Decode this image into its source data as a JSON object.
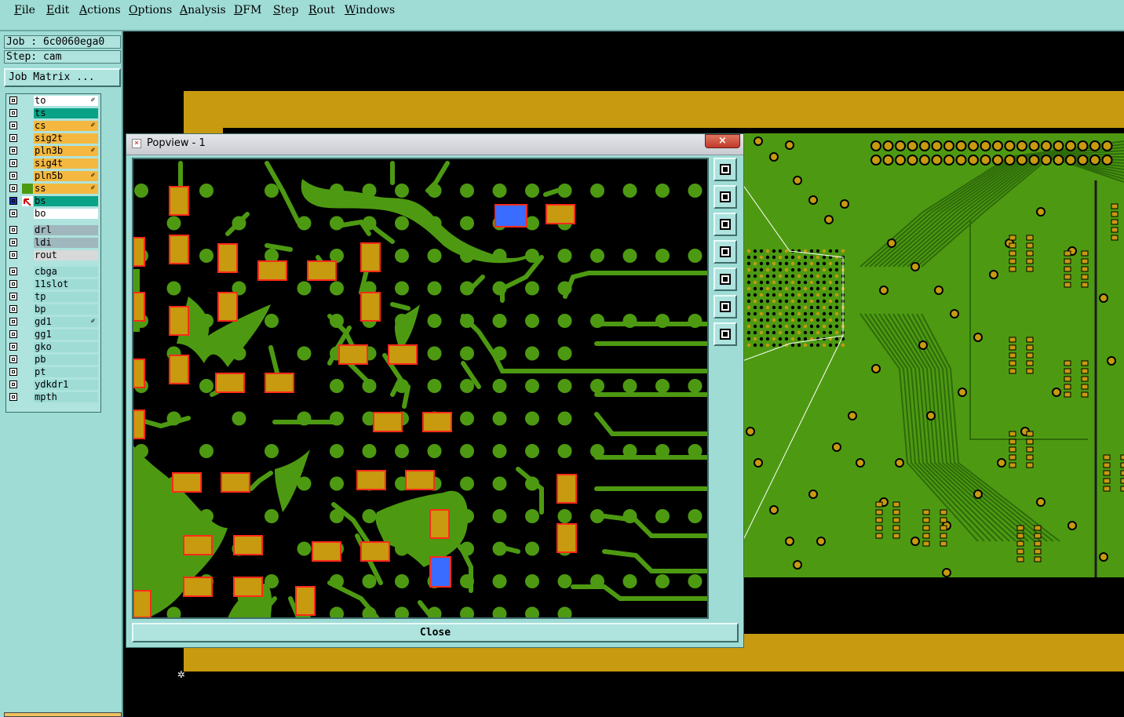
{
  "menu": [
    "File",
    "Edit",
    "Actions",
    "Options",
    "Analysis",
    "DFM",
    "Step",
    "Rout",
    "Windows"
  ],
  "job": {
    "label": "Job : 6c0060ega0",
    "step": "Step: cam",
    "matrix_button": "Job Matrix ..."
  },
  "layers": {
    "group1": [
      {
        "name": "to",
        "color": "#ffffff",
        "mark": true
      },
      {
        "name": "ts",
        "color": "#0aa286",
        "mark": false
      },
      {
        "name": "cs",
        "color": "#f4b840",
        "mark": true
      },
      {
        "name": "sig2t",
        "color": "#f4b840",
        "mark": false
      },
      {
        "name": "pln3b",
        "color": "#f4b840",
        "mark": true
      },
      {
        "name": "sig4t",
        "color": "#f4b840",
        "mark": false
      },
      {
        "name": "pln5b",
        "color": "#f4b840",
        "mark": true
      },
      {
        "name": "ss",
        "color": "#f4b840",
        "mark": true
      },
      {
        "name": "bs",
        "color": "#0aa286",
        "mark": false
      },
      {
        "name": "bo",
        "color": "#ffffff",
        "mark": false
      }
    ],
    "group2": [
      {
        "name": "drl",
        "color": "#9fb7bd"
      },
      {
        "name": "ldi",
        "color": "#9fb7bd"
      },
      {
        "name": "rout",
        "color": "#d9d9d9"
      }
    ],
    "group3": [
      {
        "name": "cbga",
        "color": "#9fdcd6",
        "mark": false
      },
      {
        "name": "11slot",
        "color": "#9fdcd6",
        "mark": false
      },
      {
        "name": "tp",
        "color": "#9fdcd6",
        "mark": false
      },
      {
        "name": "bp",
        "color": "#9fdcd6",
        "mark": false
      },
      {
        "name": "gd1",
        "color": "#9fdcd6",
        "mark": true
      },
      {
        "name": "gg1",
        "color": "#9fdcd6",
        "mark": false
      },
      {
        "name": "gko",
        "color": "#9fdcd6",
        "mark": false
      },
      {
        "name": "pb",
        "color": "#9fdcd6",
        "mark": false
      },
      {
        "name": "pt",
        "color": "#9fdcd6",
        "mark": false
      },
      {
        "name": "ydkdr1",
        "color": "#9fdcd6",
        "mark": false
      },
      {
        "name": "mpth",
        "color": "#9fdcd6",
        "mark": false
      }
    ]
  },
  "popview": {
    "title": "Popview - 1",
    "close_label": "Close",
    "tools": [
      "zoom-window-icon",
      "pan-up-icon",
      "pan-down-icon",
      "pan-left-icon",
      "pan-right-icon",
      "zoom-fit-icon",
      "zoom-home-icon"
    ]
  },
  "colors": {
    "copper": "#4d9a12",
    "pad": "#c79a10",
    "pad_outline": "#ff2a1a",
    "selected_pad": "#3a6cff",
    "panel": "#9fdcd6"
  }
}
